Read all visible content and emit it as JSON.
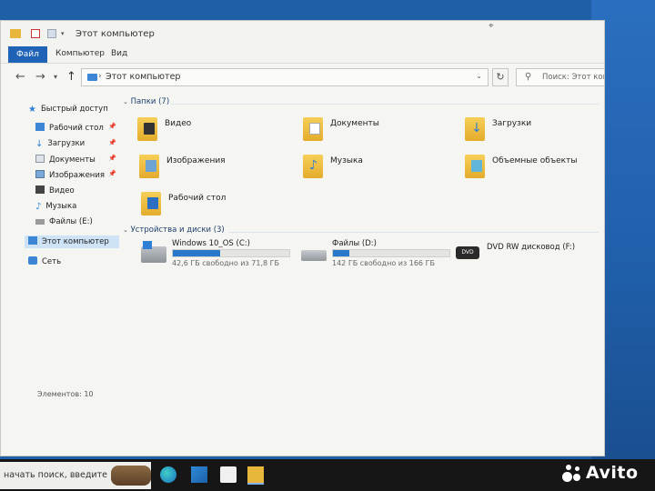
{
  "window": {
    "title": "Этот компьютер"
  },
  "ribbon": {
    "tabs": [
      "Файл",
      "Компьютер",
      "Вид"
    ]
  },
  "address": {
    "path": "Этот компьютер",
    "search_placeholder": "Поиск: Этот компьютер"
  },
  "sidebar": {
    "items": [
      {
        "label": "Быстрый доступ",
        "icon": "star-icon",
        "pinned": false
      },
      {
        "label": "Рабочий стол",
        "icon": "desktop-icon",
        "pinned": true
      },
      {
        "label": "Загрузки",
        "icon": "download-icon",
        "pinned": true
      },
      {
        "label": "Документы",
        "icon": "documents-icon",
        "pinned": true
      },
      {
        "label": "Изображения",
        "icon": "images-icon",
        "pinned": true
      },
      {
        "label": "Видео",
        "icon": "video-icon",
        "pinned": false
      },
      {
        "label": "Музыка",
        "icon": "music-icon",
        "pinned": false
      },
      {
        "label": "Файлы (E:)",
        "icon": "drive-icon",
        "pinned": false
      },
      {
        "label": "Этот компьютер",
        "icon": "computer-icon",
        "pinned": false
      },
      {
        "label": "Сеть",
        "icon": "network-icon",
        "pinned": false
      }
    ]
  },
  "folders": {
    "header": "Папки (7)",
    "items": [
      {
        "label": "Видео",
        "icon": "video-folder-icon"
      },
      {
        "label": "Документы",
        "icon": "documents-folder-icon"
      },
      {
        "label": "Загрузки",
        "icon": "downloads-folder-icon"
      },
      {
        "label": "Изображения",
        "icon": "images-folder-icon"
      },
      {
        "label": "Музыка",
        "icon": "music-folder-icon"
      },
      {
        "label": "Объемные объекты",
        "icon": "3d-objects-folder-icon"
      },
      {
        "label": "Рабочий стол",
        "icon": "desktop-folder-icon"
      }
    ]
  },
  "drives": {
    "header": "Устройства и диски (3)",
    "items": [
      {
        "name": "Windows 10_OS (C:)",
        "free": "42,6 ГБ свободно из 71,8 ГБ",
        "used_fraction": 0.41,
        "icon": "windows-drive-icon"
      },
      {
        "name": "Файлы (D:)",
        "free": "142 ГБ свободно из 166 ГБ",
        "used_fraction": 0.14,
        "icon": "hard-drive-icon"
      },
      {
        "name": "DVD RW дисковод (F:)",
        "icon": "dvd-drive-icon"
      }
    ]
  },
  "status": {
    "items_count": "Элементов: 10"
  },
  "taskbar": {
    "search_text": "начать поиск, введите",
    "apps": [
      "edge-icon",
      "store-icon",
      "shopping-bag-icon",
      "file-explorer-icon"
    ]
  },
  "watermark": {
    "text": "Avito"
  },
  "colors": {
    "accent": "#1f63b6",
    "bar_fill": "#2a78c9",
    "selection": "#cfe3f7",
    "desktop": "#1e5fa8",
    "folder": "#f0c24a"
  }
}
